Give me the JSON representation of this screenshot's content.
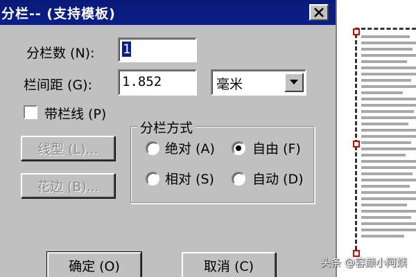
{
  "dialog": {
    "title": "分栏-- (支持模板)",
    "columns_label": "分栏数 (N):",
    "columns_value": "1",
    "gap_label": "栏间距 (G):",
    "gap_value": "1.852",
    "unit_selected": "毫米",
    "divider_label": "带栏线 (P)",
    "divider_checked": false,
    "line_style_button": "线型 (L)...",
    "border_button": "花边 (B)...",
    "group_title": "分栏方式",
    "radio_absolute": "绝对 (A)",
    "radio_free": "自由 (F)",
    "radio_relative": "相对 (S)",
    "radio_auto": "自动 (D)",
    "selected_mode": "自由 (F)",
    "ok_button": "确定 (O)",
    "cancel_button": "取消 (C)"
  },
  "watermark": "头条 @容颜小阿姨",
  "colors": {
    "titlebar": "#0b1f86",
    "dialog_bg": "#c0c0c0",
    "handle": "#e00000"
  }
}
